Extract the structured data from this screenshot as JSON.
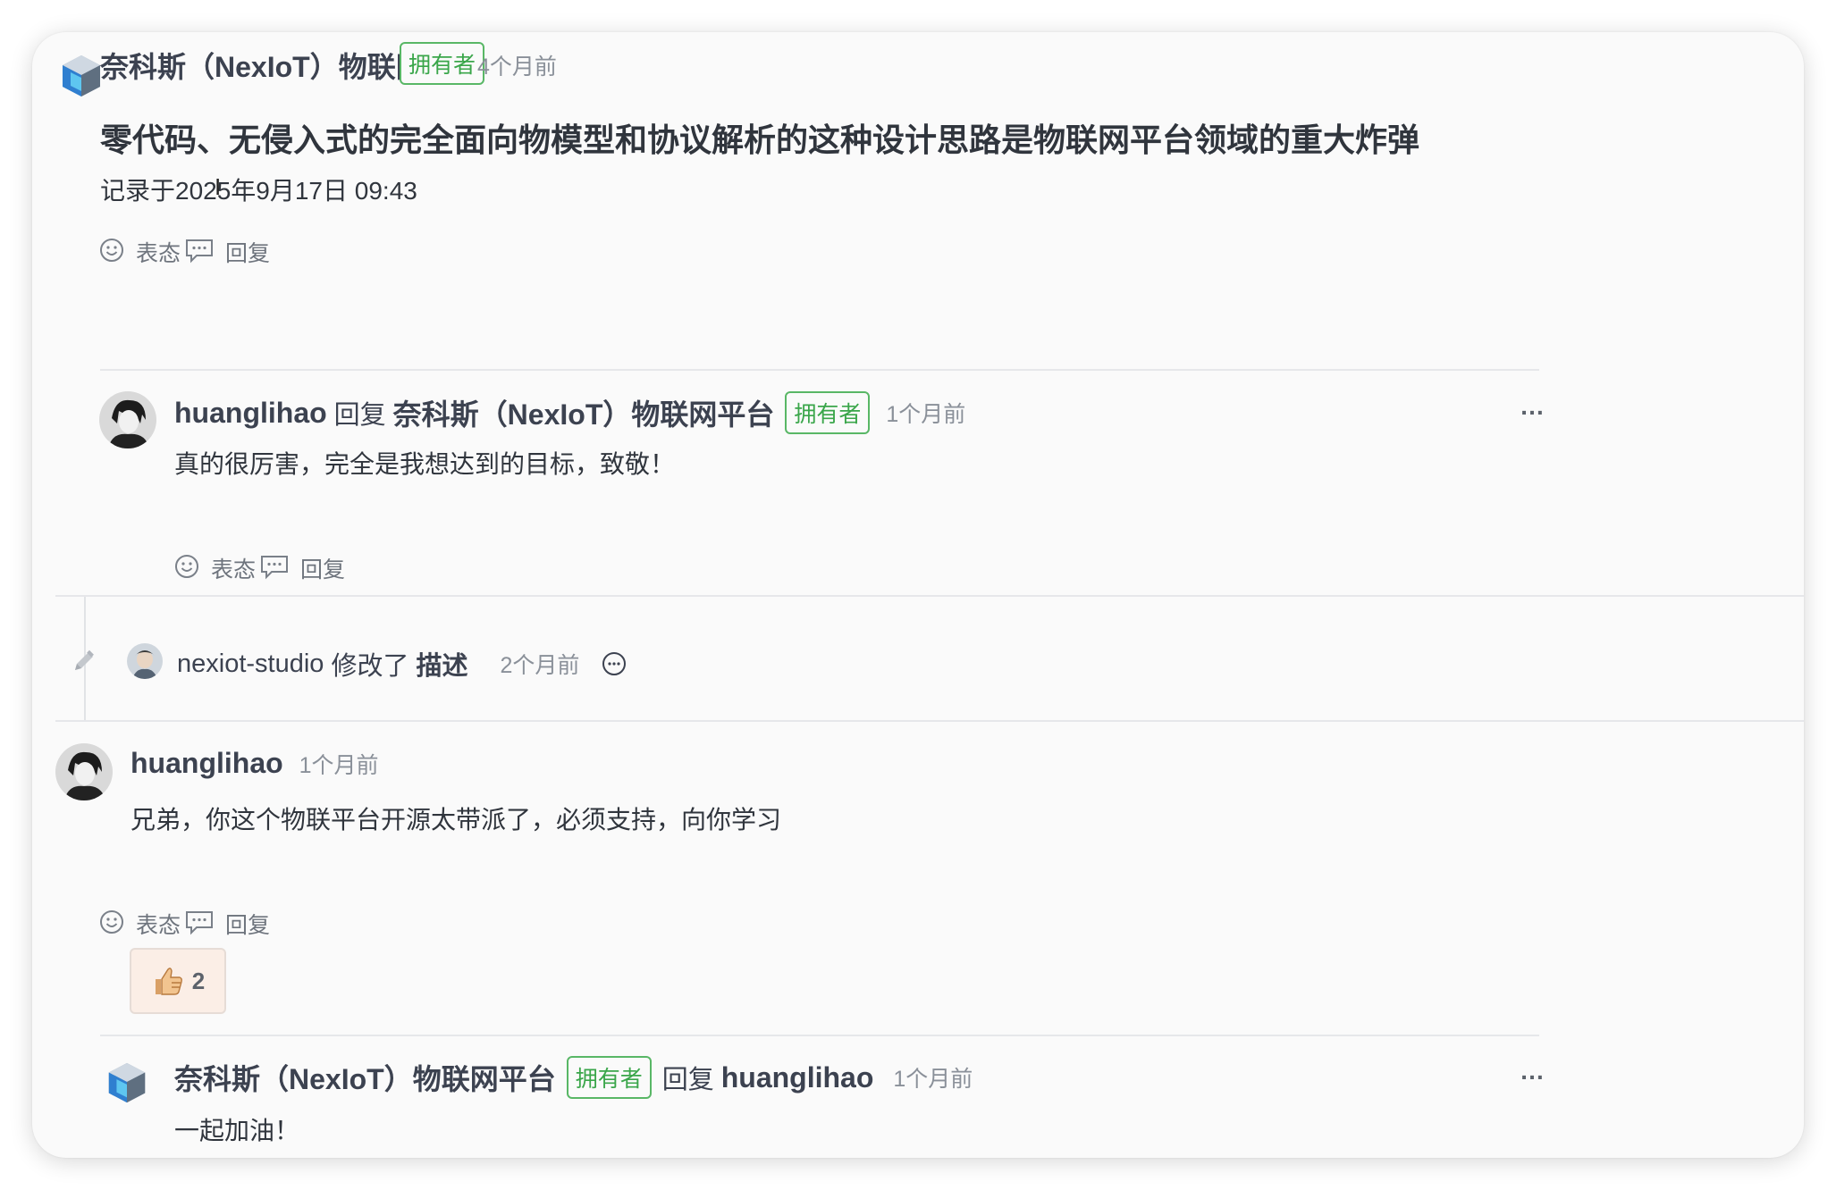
{
  "post": {
    "author": "奈科斯（NexIoT）物联网平台",
    "badge": "拥有者",
    "time": "4个月前",
    "title": "零代码、无侵入式的完全面向物模型和协议解析的这种设计思路是物联网平台领域的重大炸弹",
    "recorded": "记录于2025年9月17日 09:43",
    "react_label": "表态",
    "reply_label": "回复"
  },
  "reply1": {
    "author": "huanglihao",
    "reply_word": "回复",
    "target": "奈科斯（NexIoT）物联网平台",
    "badge": "拥有者",
    "time": "1个月前",
    "body": "真的很厉害，完全是我想达到的目标，致敬！",
    "react_label": "表态",
    "reply_label": "回复",
    "more": "…"
  },
  "event": {
    "user": "nexiot-studio",
    "action": "修改了",
    "field": "描述",
    "time": "2个月前"
  },
  "comment2": {
    "author": "huanglihao",
    "time": "1个月前",
    "body": "兄弟，你这个物联平台开源太带派了，必须支持，向你学习",
    "react_label": "表态",
    "reply_label": "回复",
    "reaction_emoji": "thumbs-up",
    "reaction_count": "2"
  },
  "reply2": {
    "author": "奈科斯（NexIoT）物联网平台",
    "badge": "拥有者",
    "reply_word": "回复",
    "target": "huanglihao",
    "time": "1个月前",
    "body": "一起加油！",
    "more": "…"
  },
  "colors": {
    "badge_green": "#3aa64a",
    "card_bg": "#fafafa",
    "text_dark": "#30353d",
    "text_muted": "#8a9099"
  }
}
